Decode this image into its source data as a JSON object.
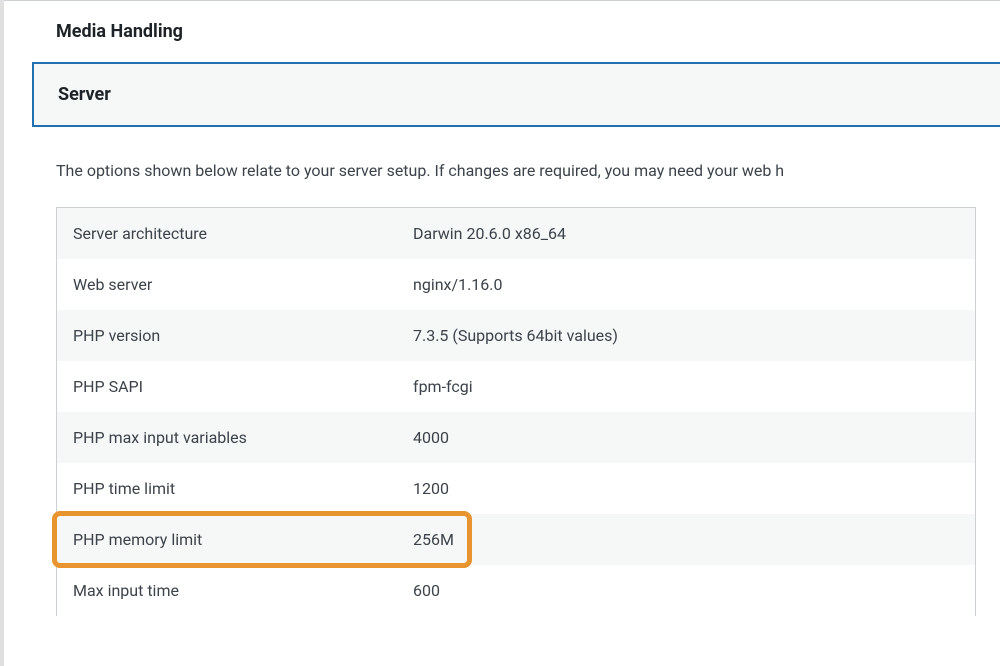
{
  "sections": {
    "media_handling": {
      "title": "Media Handling"
    },
    "server": {
      "title": "Server",
      "description": "The options shown below relate to your server setup. If changes are required, you may need your web h",
      "rows": [
        {
          "label": "Server architecture",
          "value": "Darwin 20.6.0 x86_64"
        },
        {
          "label": "Web server",
          "value": "nginx/1.16.0"
        },
        {
          "label": "PHP version",
          "value": "7.3.5 (Supports 64bit values)"
        },
        {
          "label": "PHP SAPI",
          "value": "fpm-fcgi"
        },
        {
          "label": "PHP max input variables",
          "value": "4000"
        },
        {
          "label": "PHP time limit",
          "value": "1200"
        },
        {
          "label": "PHP memory limit",
          "value": "256M"
        },
        {
          "label": "Max input time",
          "value": "600"
        }
      ]
    }
  },
  "highlight": {
    "row_index": 6
  }
}
